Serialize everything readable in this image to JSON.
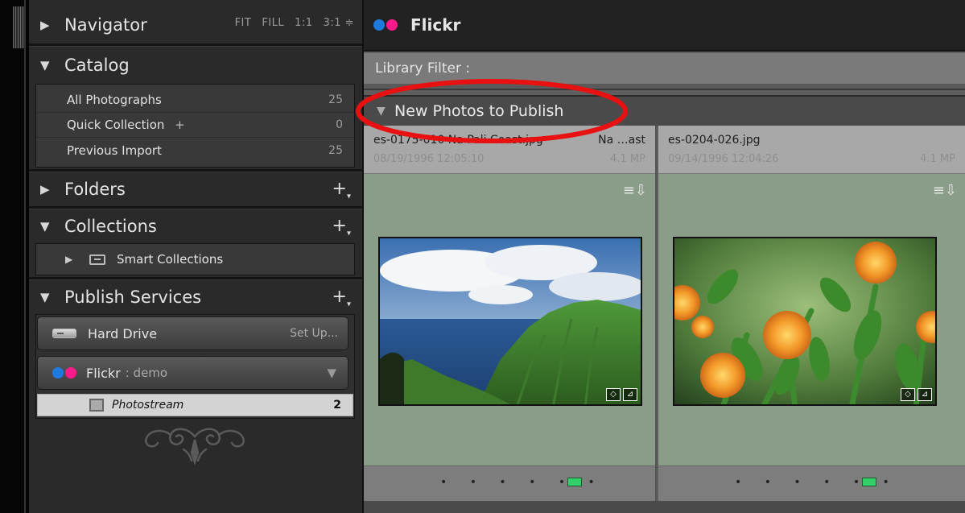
{
  "left_panel": {
    "navigator": {
      "title": "Navigator",
      "zoom": [
        "FIT",
        "FILL",
        "1:1",
        "3:1 ≑"
      ]
    },
    "catalog": {
      "title": "Catalog",
      "items": [
        {
          "label": "All Photographs",
          "count": "25"
        },
        {
          "label": "Quick Collection",
          "suffix": "+",
          "count": "0"
        },
        {
          "label": "Previous Import",
          "count": "25"
        }
      ]
    },
    "folders": {
      "title": "Folders"
    },
    "collections": {
      "title": "Collections",
      "smart": "Smart Collections"
    },
    "publish_services": {
      "title": "Publish Services",
      "hard_drive": {
        "label": "Hard Drive",
        "action": "Set Up..."
      },
      "flickr": {
        "label": "Flickr",
        "account": ": demo"
      },
      "photostream": {
        "label": "Photostream",
        "count": "2"
      }
    }
  },
  "main": {
    "header": {
      "title": "Flickr"
    },
    "filter": {
      "label": "Library Filter :"
    },
    "group": {
      "title": "New Photos to Publish"
    },
    "photos": [
      {
        "filename": "es-0175-010 Na Pali Coast.jpg",
        "title": "Na …ast",
        "date": "08/19/1996 12:05:10",
        "mp": "4.1 MP"
      },
      {
        "filename": "es-0204-026.jpg",
        "title": "",
        "date": "09/14/1996 12:04:26",
        "mp": "4.1 MP"
      }
    ],
    "footer_dots": "• • • • • •"
  },
  "colors": {
    "flickr_blue": "#1f7ae0",
    "flickr_pink": "#ff1a8c",
    "highlight_ellipse": "#e81010",
    "pick_green": "#33d06a"
  }
}
